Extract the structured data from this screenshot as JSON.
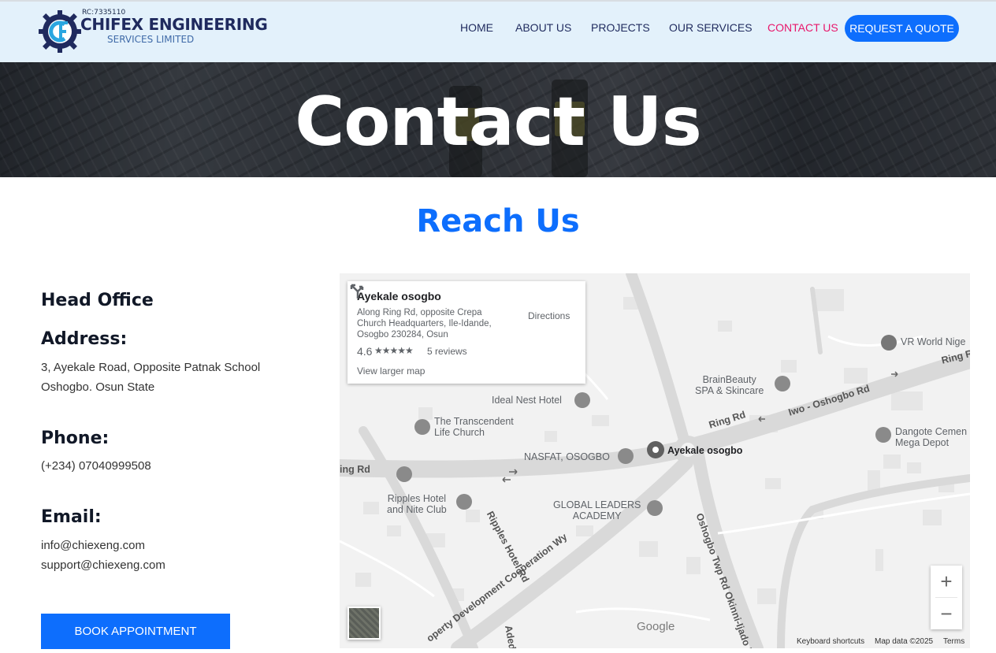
{
  "header": {
    "logo": {
      "rc": "RC:7335110",
      "name": "CHIFEX ENGINEERING",
      "sub": "SERVICES LIMITED",
      "icon": "gear-logo-icon"
    },
    "nav": [
      {
        "label": "HOME"
      },
      {
        "label": "ABOUT US"
      },
      {
        "label": "PROJECTS"
      },
      {
        "label": "OUR SERVICES"
      },
      {
        "label": "CONTACT US",
        "active": true
      }
    ],
    "quote_button": "REQUEST A QUOTE",
    "colors": {
      "background": "#e3f1fb",
      "nav_text": "#1f2a5e",
      "active": "#e8176b",
      "accent": "#0d6efd"
    }
  },
  "hero": {
    "title": "Contact Us"
  },
  "reach": {
    "heading": "Reach Us"
  },
  "office": {
    "heading": "Head Office",
    "address_label": "Address:",
    "address_lines": [
      "3, Ayekale Road, Opposite Patnak School",
      "Oshogbo. Osun State"
    ],
    "phone_label": "Phone:",
    "phone": "(+234) 07040999508",
    "email_label": "Email:",
    "emails": [
      "info@chiexeng.com",
      "support@chiexeng.com"
    ],
    "book_button": "BOOK APPOINTMENT"
  },
  "map": {
    "card": {
      "title": "Ayekale osogbo",
      "address": "Along Ring Rd, opposite Crepa Church Headquarters, Ile-Idande, Osogbo 230284, Osun",
      "rating": "4.6",
      "stars": "★★★★★",
      "reviews": "5 reviews",
      "larger_map": "View larger map",
      "directions": "Directions"
    },
    "pois": {
      "vr_world": "VR World Nige",
      "brainbeauty": "BrainBeauty\nSPA & Skincare",
      "ideal_nest": "Ideal Nest Hotel",
      "transcendent": "The Transcendent\nLife Church",
      "nasfat": "NASFAT, OSOGBO",
      "ayekale": "Ayekale osogbo",
      "dangote": "Dangote Cemen\nMega Depot",
      "ripples": "Ripples Hotel\nand Nite Club",
      "global_leaders": "GLOBAL LEADERS\nACADEMY"
    },
    "roads": {
      "ring_rd_1": "Ring R",
      "ring_rd_2": "Ring Rd",
      "iwo_oshogbo": "Iwo - Oshogbo Rd",
      "ring_rd_left": "ing Rd",
      "ripples_hotel_rd": "Ripples Hotel Rd",
      "property_dev": "operty Development Cooperation Wy",
      "oshogbo_twp": "Oshogbo Twp Rd Okinni-Ijado R",
      "adedar": "Adedar"
    },
    "google": "Google",
    "keyboard": "Keyboard shortcuts",
    "map_data": "Map data ©2025",
    "terms": "Terms"
  }
}
